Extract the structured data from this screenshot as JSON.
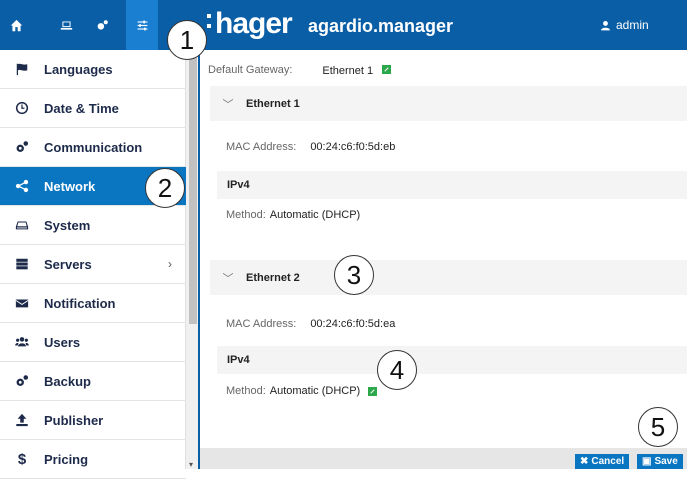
{
  "header": {
    "brand": "hager",
    "product": "agardio.manager",
    "user": "admin",
    "nav_icons": [
      "home-icon",
      "laptop-icon",
      "gears-icon",
      "sliders-icon"
    ]
  },
  "sidebar": {
    "items": [
      {
        "label": "Languages",
        "icon": "flag-icon"
      },
      {
        "label": "Date & Time",
        "icon": "clock-icon"
      },
      {
        "label": "Communication",
        "icon": "gears-icon"
      },
      {
        "label": "Network",
        "icon": "share-icon"
      },
      {
        "label": "System",
        "icon": "drive-icon"
      },
      {
        "label": "Servers",
        "icon": "server-icon",
        "chevron": "›"
      },
      {
        "label": "Notification",
        "icon": "envelope-icon"
      },
      {
        "label": "Users",
        "icon": "users-icon"
      },
      {
        "label": "Backup",
        "icon": "gears-icon"
      },
      {
        "label": "Publisher",
        "icon": "upload-icon"
      },
      {
        "label": "Pricing",
        "icon": "dollar-icon"
      }
    ],
    "active": "Network"
  },
  "main": {
    "gateway_label": "Default Gateway:",
    "gateway_value": "Ethernet 1",
    "eth1": {
      "title": "Ethernet 1",
      "mac_label": "MAC Address:",
      "mac_value": "00:24:c6:f0:5d:eb",
      "ipv4": "IPv4",
      "method_label": "Method:",
      "method_value": "Automatic (DHCP)"
    },
    "eth2": {
      "title": "Ethernet 2",
      "mac_label": "MAC Address:",
      "mac_value": "00:24:c6:f0:5d:ea",
      "ipv4": "IPv4",
      "method_label": "Method:",
      "method_value": "Automatic (DHCP)"
    }
  },
  "footer": {
    "cancel": "Cancel",
    "save": "Save"
  },
  "callouts": [
    "1",
    "2",
    "3",
    "4",
    "5"
  ],
  "colors": {
    "header": "#0a5ea6",
    "active": "#0a76c2",
    "edit": "#2aa84a"
  }
}
